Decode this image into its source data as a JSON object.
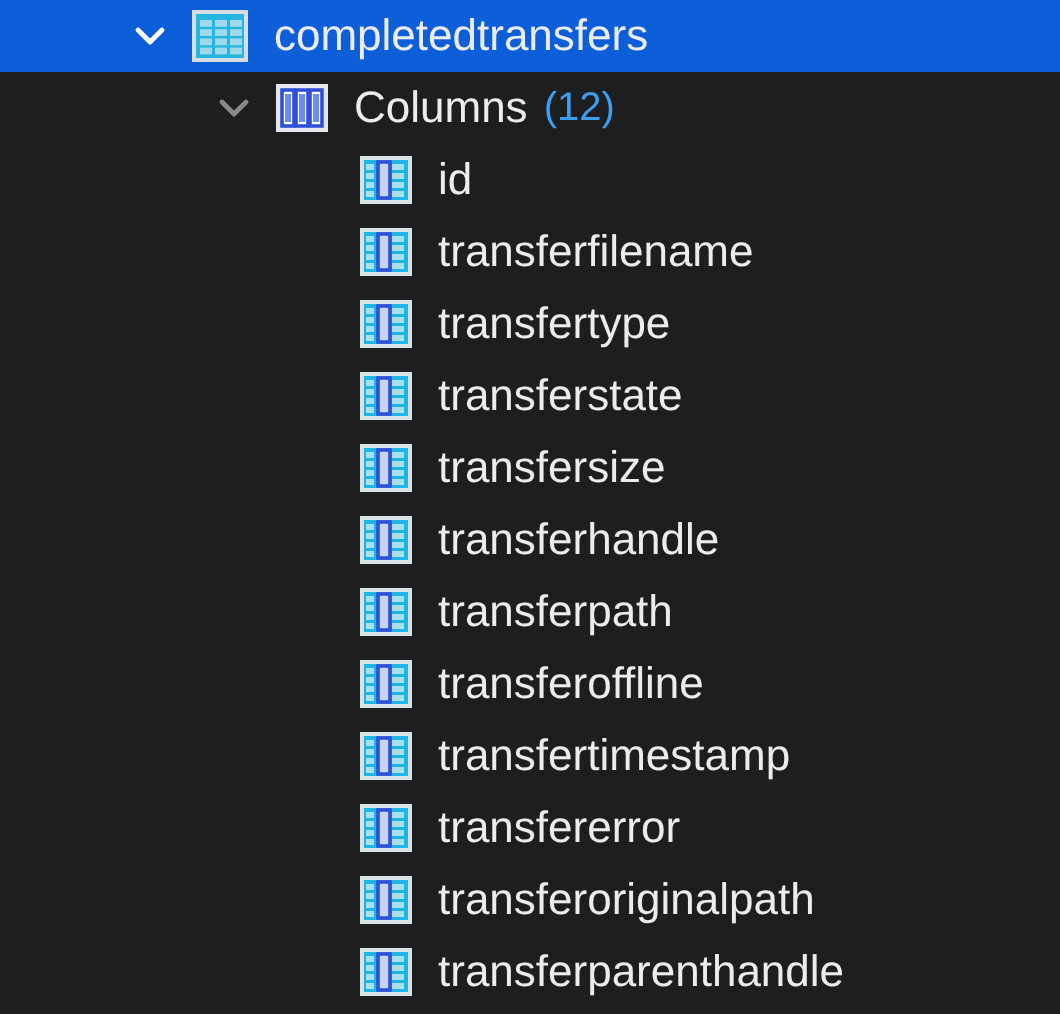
{
  "tree": [
    {
      "kind": "table",
      "label": "completedtransfers",
      "selected": true,
      "expanded": true,
      "children": [
        {
          "kind": "group",
          "label": "Columns",
          "count": "(12)",
          "selected": false,
          "expanded": true,
          "children": [
            {
              "kind": "column",
              "label": "id",
              "selected": false
            },
            {
              "kind": "column",
              "label": "transferfilename",
              "selected": false
            },
            {
              "kind": "column",
              "label": "transfertype",
              "selected": false
            },
            {
              "kind": "column",
              "label": "transferstate",
              "selected": false
            },
            {
              "kind": "column",
              "label": "transfersize",
              "selected": false
            },
            {
              "kind": "column",
              "label": "transferhandle",
              "selected": false
            },
            {
              "kind": "column",
              "label": "transferpath",
              "selected": false
            },
            {
              "kind": "column",
              "label": "transferoffline",
              "selected": false
            },
            {
              "kind": "column",
              "label": "transfertimestamp",
              "selected": false
            },
            {
              "kind": "column",
              "label": "transfererror",
              "selected": false
            },
            {
              "kind": "column",
              "label": "transferoriginalpath",
              "selected": false
            },
            {
              "kind": "column",
              "label": "transferparenthandle",
              "selected": false
            }
          ]
        }
      ]
    }
  ]
}
